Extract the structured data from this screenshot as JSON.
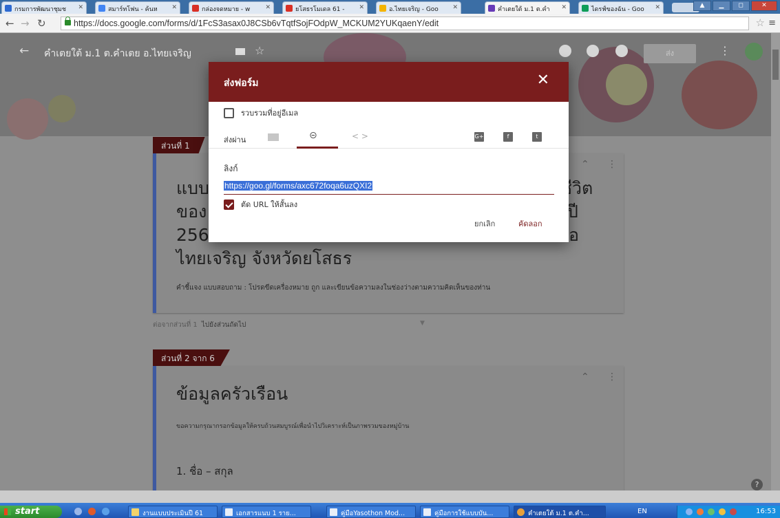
{
  "browser": {
    "tabs": [
      {
        "title": "กรมการพัฒนาชุมช",
        "favicon_color": "#2e6ad1"
      },
      {
        "title": "สมาร์ทโฟน - ค้นห",
        "favicon_color": "#4285f4"
      },
      {
        "title": "กล่องจดหมาย - w",
        "favicon_color": "#d93025"
      },
      {
        "title": "ยโสธรโมเดล 61 -",
        "favicon_color": "#d93025"
      },
      {
        "title": "อ.ไทยเจริญ - Goo",
        "favicon_color": "#f4b400"
      },
      {
        "title": "คำเตยใต้ ม.1 ต.คำ",
        "favicon_color": "#673ab7",
        "active": true
      },
      {
        "title": "ไดรฟ์ของฉัน - Goo",
        "favicon_color": "#0f9d58"
      }
    ],
    "url": "https://docs.google.com/forms/d/1FcS3asax0J8CSb6vTqtfSojFOdpW_MCKUM2YUKqaenY/edit"
  },
  "forms_header": {
    "title": "คำเตยใต้ ม.1 ต.คำเตย อ.ไทยเจริญ",
    "send_label": "ส่ง"
  },
  "form": {
    "section1_tab": "ส่วนที่ 1",
    "title_lines": [
      "แบบ",
      "ของ",
      "256",
      "ไทยเจริญ  จังหวัดยโสธร"
    ],
    "title_right": [
      "ชีวิต",
      "ปี",
      "อ"
    ],
    "description": "คำชี้แจง แบบสอบถาม : โปรดขีดเครื่องหมาย  ถูก  และเขียนข้อความลงในช่องว่างตามความคิดเห็นของท่าน",
    "after_section_label": "ต่อจากส่วนที่ 1",
    "after_section_value": "ไปยังส่วนถัดไป",
    "section2_tab": "ส่วนที่ 2 จาก 6",
    "section2_title": "ข้อมูลครัวเรือน",
    "section2_desc": "ขอความกรุณากรอกข้อมูลให้ครบถ้วนสมบูรณ์เพื่อนำไปวิเคราะห์เป็นภาพรวมของหมู่บ้าน",
    "question1": "1. ชื่อ – สกุล"
  },
  "dialog": {
    "title": "ส่งฟอร์ม",
    "collect_email": "รวบรวมที่อยู่อีเมล",
    "collect_email_checked": false,
    "send_via_label": "ส่งผ่าน",
    "link_label": "ลิงก์",
    "link_url": "https://goo.gl/forms/axc672foqa6uzQXI2",
    "shorten_label": "ตัด URL ให้สั้นลง",
    "shorten_checked": true,
    "cancel_label": "ยกเลิก",
    "copy_label": "คัดลอก",
    "accent_color": "#7a1d1d"
  },
  "taskbar": {
    "start_label": "start",
    "tasks": [
      {
        "label": "งานแบบประเมินปี 61"
      },
      {
        "label": "เอกสารแนบ 1 ราย..."
      },
      {
        "label": "คู่มือYasothon Mod..."
      },
      {
        "label": "คู่มือการใช้แบบบัน..."
      },
      {
        "label": "คำเตยใต้ ม.1 ต.คำ...",
        "active": true
      }
    ],
    "language": "EN",
    "clock": "16:53"
  }
}
